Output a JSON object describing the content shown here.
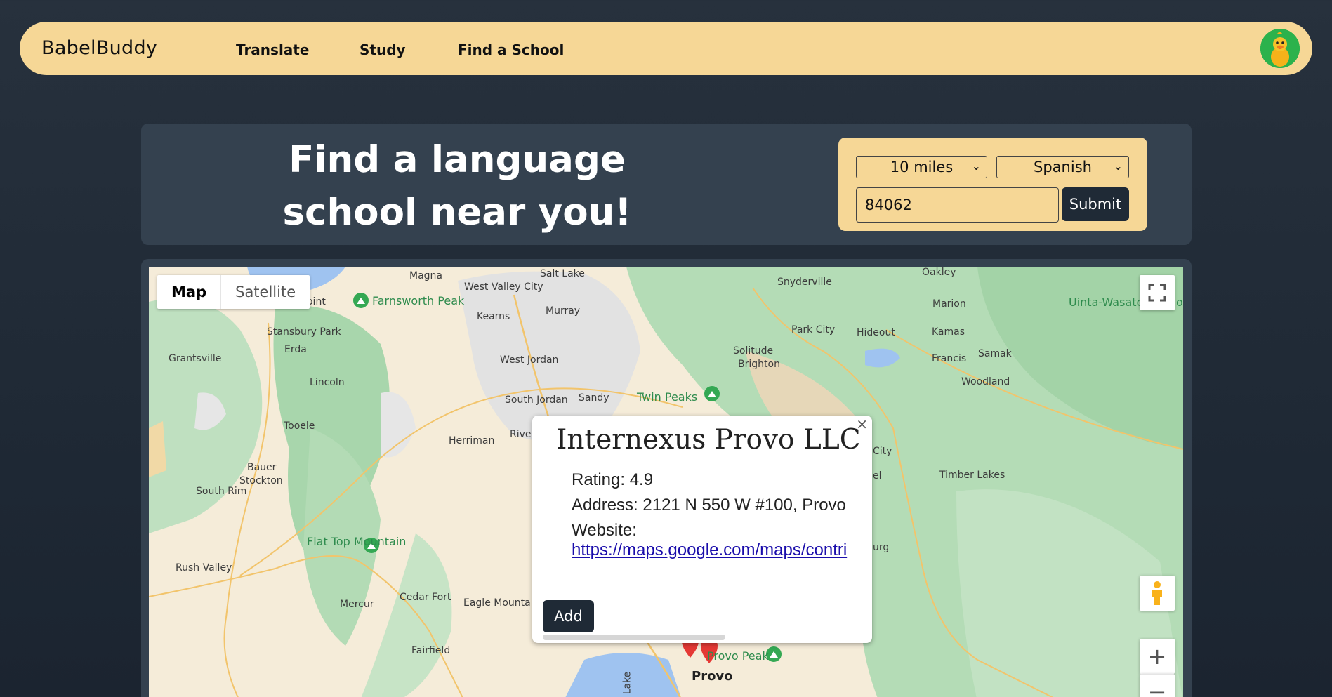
{
  "navbar": {
    "brand": "BabelBuddy",
    "links": [
      "Translate",
      "Study",
      "Find a School"
    ]
  },
  "hero": {
    "title": "Find a language school near you!",
    "distance": "10 miles",
    "language": "Spanish",
    "zip": "84062",
    "submit_label": "Submit"
  },
  "map": {
    "type_map": "Map",
    "type_satellite": "Satellite",
    "zoom_in": "+",
    "zoom_out": "−",
    "labels": {
      "magna": "Magna",
      "saltlake": "Salt Lake",
      "westvalley": "West Valley City",
      "murray": "Murray",
      "kearns": "Kearns",
      "snyderville": "Snyderville",
      "oakley": "Oakley",
      "marion": "Marion",
      "uinta": "Uinta-Wasatch National Forest",
      "farnsworth": "Farnsworth Peak",
      "lakepoint": "Lake Point",
      "stansbury": "Stansbury Park",
      "erda": "Erda",
      "grantsville": "Grantsville",
      "lincoln": "Lincoln",
      "tooele": "Tooele",
      "bauer": "Bauer",
      "stockton": "Stockton",
      "southrim": "South Rim",
      "flattop": "Flat Top Mountain",
      "rushvalley": "Rush Valley",
      "mercur": "Mercur",
      "cedarfort": "Cedar Fort",
      "eagle": "Eagle Mountain",
      "fairfield": "Fairfield",
      "westjordan": "West Jordan",
      "southjordan": "South Jordan",
      "sandy": "Sandy",
      "herriman": "Herriman",
      "riverton": "River",
      "twinpeaks": "Twin Peaks",
      "solitude": "Solitude",
      "brighton": "Brighton",
      "parkcity": "Park City",
      "hideout": "Hideout",
      "kamas": "Kamas",
      "samak": "Samak",
      "francis": "Francis",
      "woodland": "Woodland",
      "timberlakes": "Timber Lakes",
      "city": "City",
      "el": "el",
      "urg": "urg",
      "provopeak": "Provo Peak",
      "provo": "Provo",
      "lake": "Lake"
    }
  },
  "info": {
    "title": "Internexus Provo LLC",
    "rating": "Rating: 4.9",
    "address": "Address: 2121 N 550 W #100, Provo",
    "website_label": "Website:",
    "website_url": "https://maps.google.com/maps/contri",
    "add_label": "Add",
    "close": "×"
  }
}
